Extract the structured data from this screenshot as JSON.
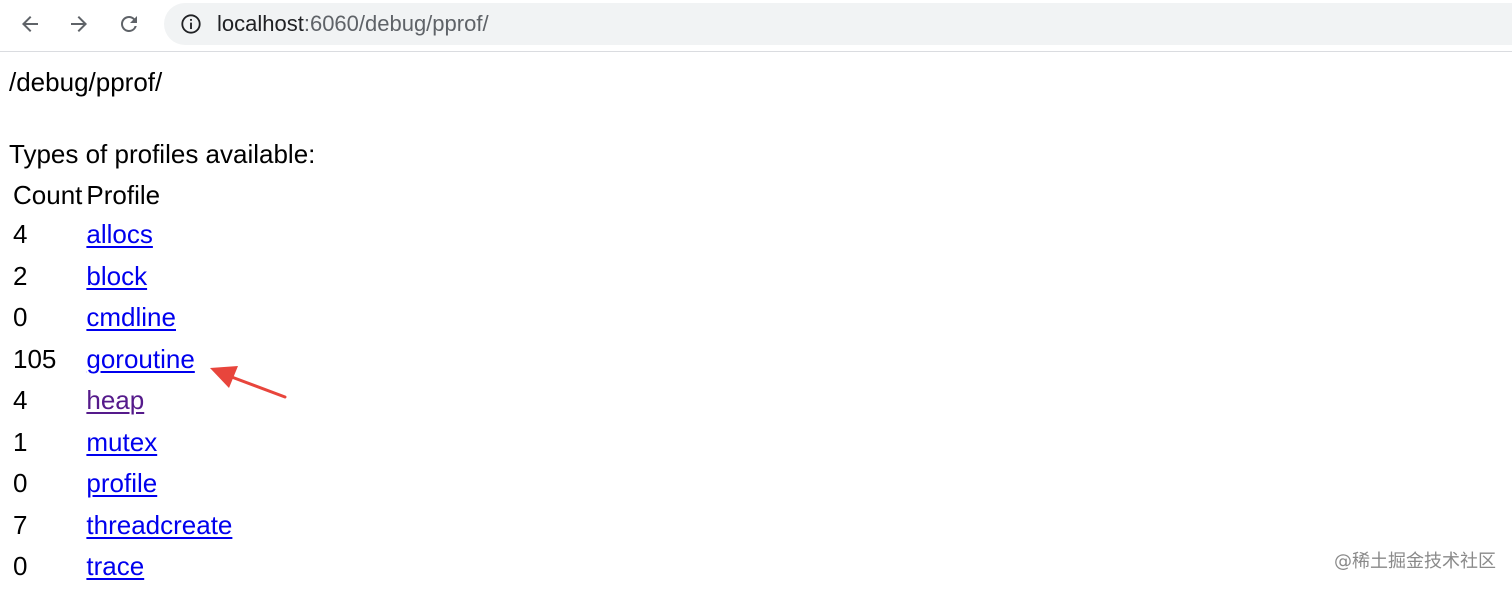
{
  "browser": {
    "url_host": "localhost",
    "url_path": ":6060/debug/pprof/",
    "icons": {
      "back": "arrow-left",
      "forward": "arrow-right",
      "reload": "reload",
      "site_info": "info-circle"
    }
  },
  "page": {
    "path_heading": "/debug/pprof/",
    "types_heading": "Types of profiles available:",
    "table": {
      "columns": [
        "Count",
        "Profile"
      ],
      "rows": [
        {
          "count": "4",
          "profile": "allocs",
          "visited": false
        },
        {
          "count": "2",
          "profile": "block",
          "visited": false
        },
        {
          "count": "0",
          "profile": "cmdline",
          "visited": false
        },
        {
          "count": "105",
          "profile": "goroutine",
          "visited": false
        },
        {
          "count": "4",
          "profile": "heap",
          "visited": true
        },
        {
          "count": "1",
          "profile": "mutex",
          "visited": false
        },
        {
          "count": "0",
          "profile": "profile",
          "visited": false
        },
        {
          "count": "7",
          "profile": "threadcreate",
          "visited": false
        },
        {
          "count": "0",
          "profile": "trace",
          "visited": false
        }
      ]
    }
  },
  "annotation": {
    "arrow_color": "#e8453c",
    "points_to": "goroutine"
  },
  "watermark": "@稀土掘金技术社区",
  "colors": {
    "link": "#0000ee",
    "visited_link": "#551a8b",
    "omnibox_bg": "#f1f3f4"
  }
}
